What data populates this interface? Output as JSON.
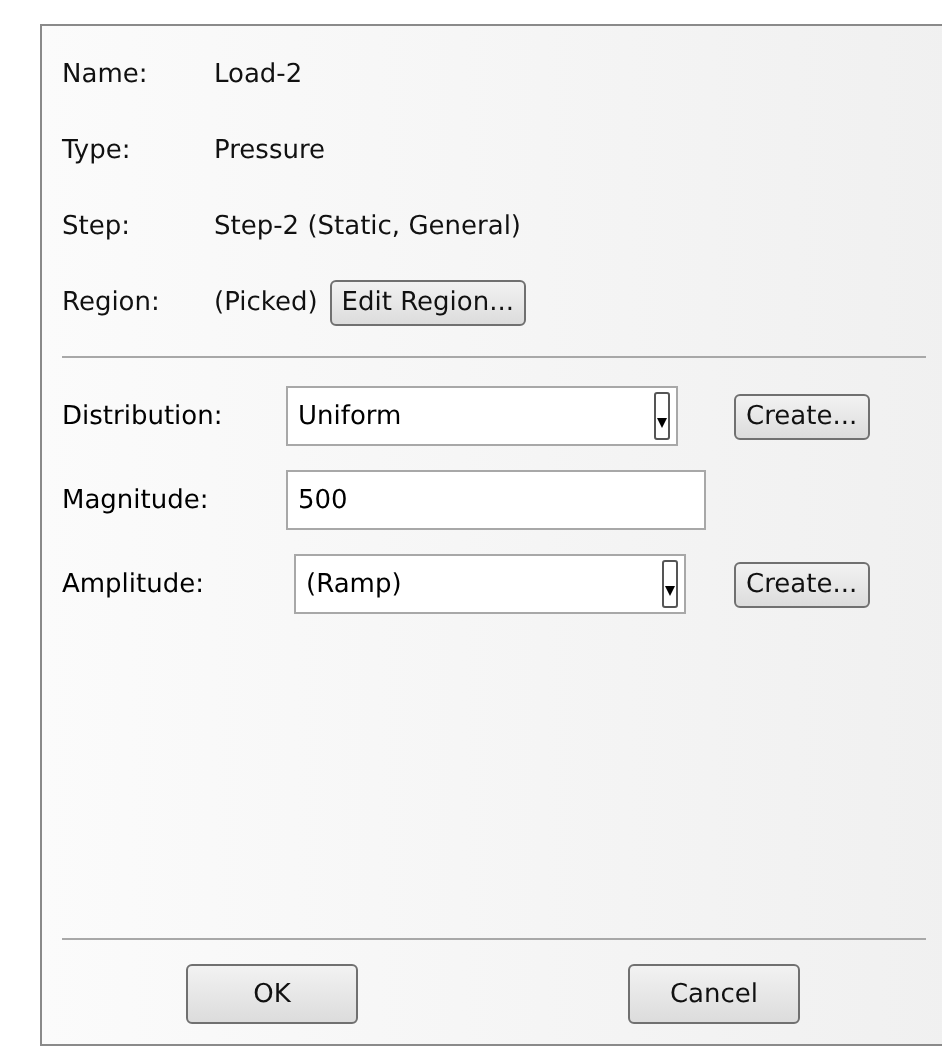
{
  "info": [
    {
      "label": "Name:",
      "value": "Load-2"
    },
    {
      "label": "Type:",
      "value": "Pressure"
    },
    {
      "label": "Step:",
      "value": "Step-2 (Static, General)"
    }
  ],
  "region": {
    "label": "Region:",
    "value": "(Picked)",
    "button": "Edit Region..."
  },
  "fields": [
    {
      "kind": "dropdown",
      "label": "Distribution:",
      "value": "Uniform",
      "button": "Create..."
    },
    {
      "kind": "text",
      "label": "Magnitude:",
      "value": "500"
    },
    {
      "kind": "dropdown",
      "label": "Amplitude:",
      "value": "(Ramp)",
      "button": "Create..."
    }
  ],
  "buttons": [
    "OK",
    "Cancel"
  ]
}
